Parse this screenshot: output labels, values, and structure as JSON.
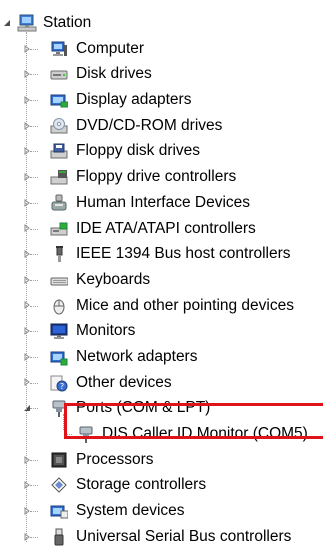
{
  "root": {
    "label": "Station",
    "icon": "computer-station-icon",
    "expanded": true
  },
  "items": [
    {
      "label": "Computer",
      "icon": "computer-icon",
      "expanded": false
    },
    {
      "label": "Disk drives",
      "icon": "disk-drive-icon",
      "expanded": false
    },
    {
      "label": "Display adapters",
      "icon": "display-adapter-icon",
      "expanded": false
    },
    {
      "label": "DVD/CD-ROM drives",
      "icon": "dvd-drive-icon",
      "expanded": false
    },
    {
      "label": "Floppy disk drives",
      "icon": "floppy-disk-icon",
      "expanded": false
    },
    {
      "label": "Floppy drive controllers",
      "icon": "floppy-controller-icon",
      "expanded": false
    },
    {
      "label": "Human Interface Devices",
      "icon": "hid-icon",
      "expanded": false
    },
    {
      "label": "IDE ATA/ATAPI controllers",
      "icon": "ide-controller-icon",
      "expanded": false
    },
    {
      "label": "IEEE 1394 Bus host controllers",
      "icon": "ieee1394-icon",
      "expanded": false
    },
    {
      "label": "Keyboards",
      "icon": "keyboard-icon",
      "expanded": false
    },
    {
      "label": "Mice and other pointing devices",
      "icon": "mouse-icon",
      "expanded": false
    },
    {
      "label": "Monitors",
      "icon": "monitor-icon",
      "expanded": false
    },
    {
      "label": "Network adapters",
      "icon": "network-adapter-icon",
      "expanded": false
    },
    {
      "label": "Other devices",
      "icon": "unknown-device-icon",
      "expanded": false
    },
    {
      "label": "Ports (COM & LPT)",
      "icon": "port-icon",
      "expanded": true,
      "children": [
        {
          "label": "DIS Caller ID Monitor (COM5)",
          "icon": "port-icon"
        }
      ]
    },
    {
      "label": "Processors",
      "icon": "processor-icon",
      "expanded": false
    },
    {
      "label": "Storage controllers",
      "icon": "storage-controller-icon",
      "expanded": false
    },
    {
      "label": "System devices",
      "icon": "system-device-icon",
      "expanded": false
    },
    {
      "label": "Universal Serial Bus controllers",
      "icon": "usb-icon",
      "expanded": false
    }
  ],
  "colors": {
    "highlight_border": "#e0131b"
  }
}
